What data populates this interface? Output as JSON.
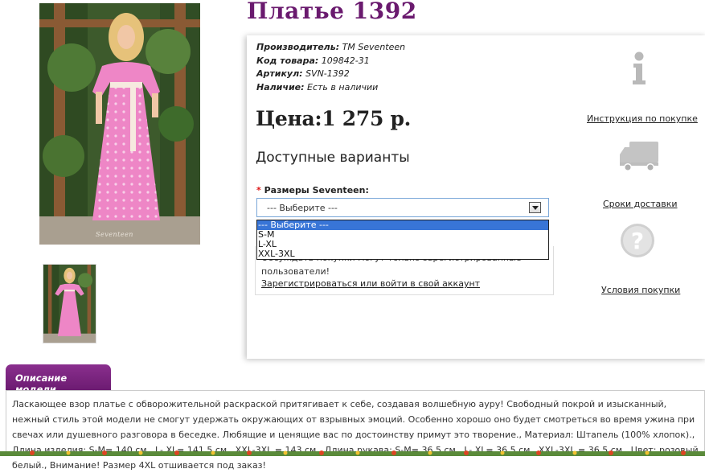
{
  "product": {
    "title": "Платье 1392",
    "manufacturer_label": "Производитель:",
    "manufacturer_value": "ТМ Seventeen",
    "code_label": "Код товара:",
    "code_value": "109842-31",
    "article_label": "Артикул:",
    "article_value": "SVN-1392",
    "availability_label": "Наличие:",
    "availability_value": "Есть в наличии",
    "price": "Цена:1 275 р.",
    "photo_watermark": "Seventeen"
  },
  "options": {
    "title": "Доступные варианты",
    "size_label": "Размеры Seventeen:",
    "required_mark": "*",
    "selected": "--- Выберите ---",
    "items": [
      "--- Выберите ---",
      "S-M",
      "L-XL",
      "XXL-3XL"
    ]
  },
  "notice": {
    "text": "Обсуждать покупки могут только зарегистрированные пользователи!",
    "link": "Зарегистрироваться или войти в свой аккаунт"
  },
  "sidebar": {
    "instructions": "Инструкция по покупке",
    "delivery": "Сроки доставки",
    "terms": "Условия покупки"
  },
  "description": {
    "tab": "Описание модели",
    "text": "Ласкающее взор платье с обворожительной раскраской притягивает к себе, создавая волшебную ауру! Свободный покрой и изысканный, нежный стиль этой модели не смогут удержать окружающих от взрывных эмоций. Особенно хорошо оно будет смотреться во время ужина при свечах или душевного разговора в беседке. Любящие и ценящие вас по достоинству примут это творение., Материал: Штапель (100% хлопок)., Длина изделия: S-M= 140 см., L- XL= 141,5 см., XXL-3XL = 143 см., Длина рукава: S-M= 36,5 см., L- XL= 36,5 см., XXL-3XL = 36,5 см., Цвет: розовый, белый., Внимание! Размер 4XL отшивается под заказ!"
  },
  "colors": {
    "brand": "#6a1a6e",
    "dress": "#ee86c6",
    "select_highlight": "#3875d7"
  }
}
